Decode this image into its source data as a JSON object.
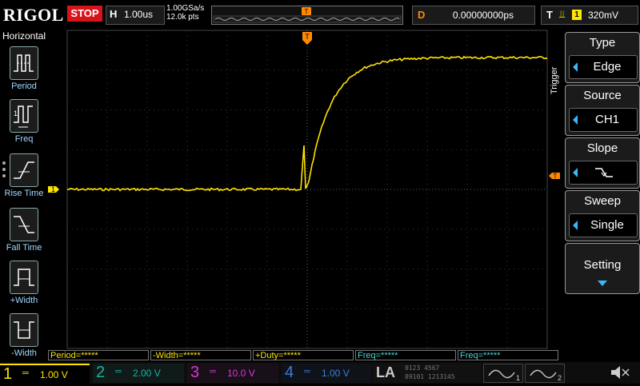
{
  "top": {
    "brand": "RIGOL",
    "run_state": "STOP",
    "horizontal_key": "H",
    "timebase": "1.00us",
    "sample_rate": "1.00GSa/s",
    "memory_depth": "12.0k pts",
    "trigger_position_marker": "T",
    "delay_key": "D",
    "delay_value": "0.00000000ps",
    "trigger_key": "T",
    "trigger_channel": "1",
    "trigger_level": "320mV"
  },
  "left_menu": {
    "title": "Horizontal",
    "items": [
      {
        "label": "Period"
      },
      {
        "label": "Freq"
      },
      {
        "label": "Rise Time"
      },
      {
        "label": "Fall Time"
      },
      {
        "label": "+Width"
      },
      {
        "label": "-Width"
      }
    ]
  },
  "screen": {
    "ch1_marker": "1",
    "trigger_marker": "T",
    "trigger_level_marker": "T",
    "trace_color": "#ffe400",
    "grid_color": "#3c3c3c",
    "trigger_color": "#ff8a00"
  },
  "right_menu": {
    "side_label": "Trigger",
    "type": {
      "title": "Type",
      "value": "Edge"
    },
    "source": {
      "title": "Source",
      "value": "CH1"
    },
    "slope": {
      "title": "Slope",
      "value": "falling-edge-icon"
    },
    "sweep": {
      "title": "Sweep",
      "value": "Single"
    },
    "setting": {
      "title": "Setting"
    }
  },
  "measurements": [
    {
      "label": "Period=*****"
    },
    {
      "label": "-Width=*****"
    },
    {
      "label": "+Duty=*****"
    },
    {
      "label": "Freq=*****"
    },
    {
      "label": "Freq=*****"
    }
  ],
  "channels": [
    {
      "num": "1",
      "scale": "1.00 V",
      "color": "#ffe400"
    },
    {
      "num": "2",
      "scale": "2.00 V",
      "color": "#19b5a3"
    },
    {
      "num": "3",
      "scale": "10.0 V",
      "color": "#d23bd2"
    },
    {
      "num": "4",
      "scale": "1.00 V",
      "color": "#3a7fd8"
    }
  ],
  "la": {
    "label": "LA",
    "digits": [
      "0123",
      "4567",
      "89101",
      "1213145"
    ]
  },
  "generators": [
    {
      "num": "1"
    },
    {
      "num": "2"
    }
  ]
}
